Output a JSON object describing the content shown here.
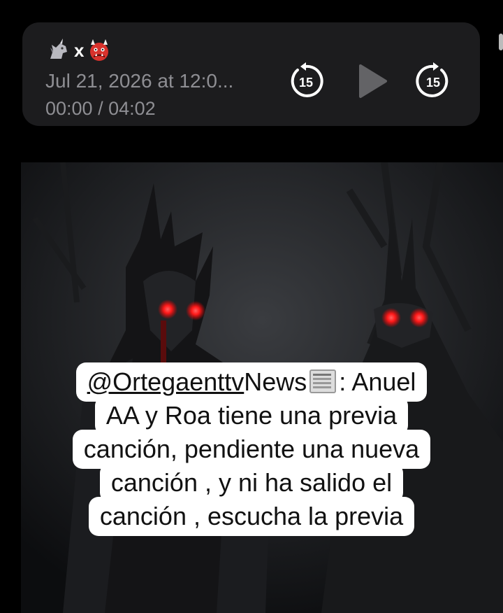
{
  "player": {
    "title_x": "x",
    "date": "Jul 21, 2026 at 12:0...",
    "time": "00:00 / 04:02",
    "skip_back_seconds": "15",
    "skip_forward_seconds": "15",
    "icons": {
      "left_emoji": "unicorn-icon",
      "right_emoji": "ogre-icon",
      "play": "play-icon",
      "skip_back": "skip-back-15-icon",
      "skip_forward": "skip-forward-15-icon"
    }
  },
  "caption": {
    "mention": "@Ortegaenttv",
    "line1_a": "News",
    "line1_b": ": Anuel",
    "line2": "AA y Roa tiene una previa",
    "line3": "canción, pendiente una nueva",
    "line4": "canción , y ni ha salido el",
    "line5": "canción , escucha la previa"
  },
  "colors": {
    "panel": "#1c1c1e",
    "muted_text": "#8e8e93",
    "eye_glow": "#ff2a2a"
  }
}
